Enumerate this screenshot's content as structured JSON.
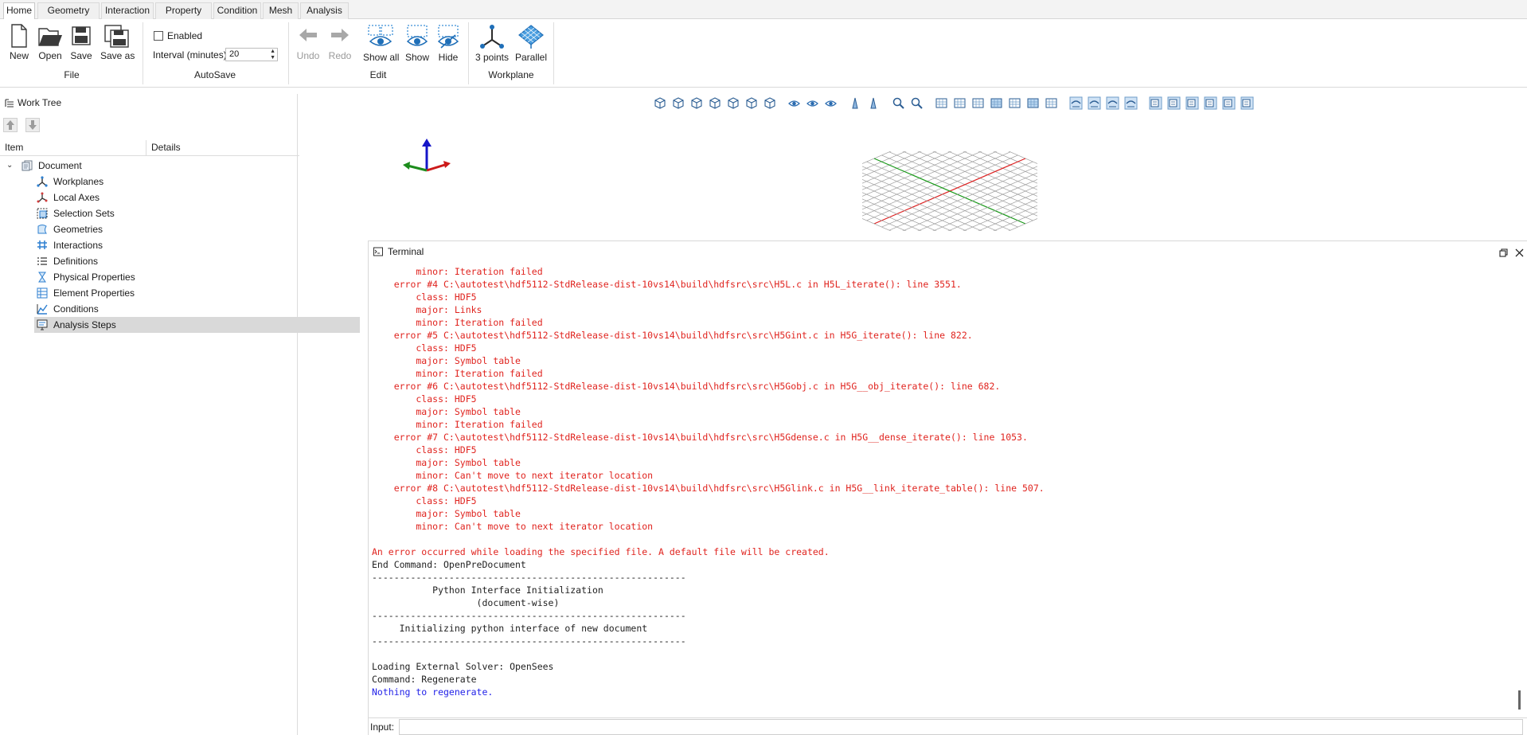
{
  "ribbon": {
    "tabs": [
      "Home",
      "Geometry",
      "Interaction",
      "Property",
      "Condition",
      "Mesh",
      "Analysis"
    ],
    "active_tab": "Home",
    "file_group": {
      "label": "File",
      "new": "New",
      "open": "Open",
      "save": "Save",
      "save_as": "Save as"
    },
    "autosave_group": {
      "label": "AutoSave",
      "enabled_label": "Enabled",
      "enabled": false,
      "interval_label": "Interval (minutes)",
      "interval_value": "20"
    },
    "edit_group": {
      "label": "Edit",
      "undo": "Undo",
      "redo": "Redo",
      "show_all": "Show all",
      "show": "Show",
      "hide": "Hide"
    },
    "workplane_group": {
      "label": "Workplane",
      "three_points": "3 points",
      "parallel": "Parallel"
    }
  },
  "worktree": {
    "title": "Work Tree",
    "columns": [
      "Item",
      "Details"
    ],
    "root": "Document",
    "items": [
      {
        "label": "Workplanes",
        "icon": "workplane-icon"
      },
      {
        "label": "Local Axes",
        "icon": "axes-icon"
      },
      {
        "label": "Selection Sets",
        "icon": "selection-set-icon"
      },
      {
        "label": "Geometries",
        "icon": "geometry-icon"
      },
      {
        "label": "Interactions",
        "icon": "interaction-icon"
      },
      {
        "label": "Definitions",
        "icon": "definition-list-icon"
      },
      {
        "label": "Physical Properties",
        "icon": "physical-property-icon"
      },
      {
        "label": "Element Properties",
        "icon": "element-property-icon"
      },
      {
        "label": "Conditions",
        "icon": "condition-icon"
      },
      {
        "label": "Analysis Steps",
        "icon": "analysis-step-icon"
      }
    ],
    "selected_item": "Analysis Steps"
  },
  "terminal": {
    "title": "Terminal",
    "input_label": "Input:",
    "input_value": "",
    "colors": {
      "error": "#e0241f",
      "normal": "#222222",
      "info": "#1f1fe8"
    },
    "lines": [
      {
        "text": "        minor: Iteration failed",
        "kind": "error"
      },
      {
        "text": "    error #4 C:\\autotest\\hdf5112-StdRelease-dist-10vs14\\build\\hdfsrc\\src\\H5L.c in H5L_iterate(): line 3551.",
        "kind": "error"
      },
      {
        "text": "        class: HDF5",
        "kind": "error"
      },
      {
        "text": "        major: Links",
        "kind": "error"
      },
      {
        "text": "        minor: Iteration failed",
        "kind": "error"
      },
      {
        "text": "    error #5 C:\\autotest\\hdf5112-StdRelease-dist-10vs14\\build\\hdfsrc\\src\\H5Gint.c in H5G_iterate(): line 822.",
        "kind": "error"
      },
      {
        "text": "        class: HDF5",
        "kind": "error"
      },
      {
        "text": "        major: Symbol table",
        "kind": "error"
      },
      {
        "text": "        minor: Iteration failed",
        "kind": "error"
      },
      {
        "text": "    error #6 C:\\autotest\\hdf5112-StdRelease-dist-10vs14\\build\\hdfsrc\\src\\H5Gobj.c in H5G__obj_iterate(): line 682.",
        "kind": "error"
      },
      {
        "text": "        class: HDF5",
        "kind": "error"
      },
      {
        "text": "        major: Symbol table",
        "kind": "error"
      },
      {
        "text": "        minor: Iteration failed",
        "kind": "error"
      },
      {
        "text": "    error #7 C:\\autotest\\hdf5112-StdRelease-dist-10vs14\\build\\hdfsrc\\src\\H5Gdense.c in H5G__dense_iterate(): line 1053.",
        "kind": "error"
      },
      {
        "text": "        class: HDF5",
        "kind": "error"
      },
      {
        "text": "        major: Symbol table",
        "kind": "error"
      },
      {
        "text": "        minor: Can't move to next iterator location",
        "kind": "error"
      },
      {
        "text": "    error #8 C:\\autotest\\hdf5112-StdRelease-dist-10vs14\\build\\hdfsrc\\src\\H5Glink.c in H5G__link_iterate_table(): line 507.",
        "kind": "error"
      },
      {
        "text": "        class: HDF5",
        "kind": "error"
      },
      {
        "text": "        major: Symbol table",
        "kind": "error"
      },
      {
        "text": "        minor: Can't move to next iterator location",
        "kind": "error"
      },
      {
        "text": "",
        "kind": "normal"
      },
      {
        "text": "An error occurred while loading the specified file. A default file will be created.",
        "kind": "error"
      },
      {
        "text": "End Command: OpenPreDocument",
        "kind": "normal"
      },
      {
        "text": "---------------------------------------------------------",
        "kind": "normal"
      },
      {
        "text": "           Python Interface Initialization",
        "kind": "normal"
      },
      {
        "text": "                   (document-wise)",
        "kind": "normal"
      },
      {
        "text": "---------------------------------------------------------",
        "kind": "normal"
      },
      {
        "text": "     Initializing python interface of new document",
        "kind": "normal"
      },
      {
        "text": "---------------------------------------------------------",
        "kind": "normal"
      },
      {
        "text": "",
        "kind": "normal"
      },
      {
        "text": "Loading External Solver: OpenSees",
        "kind": "normal"
      },
      {
        "text": "Command: Regenerate",
        "kind": "normal"
      },
      {
        "text": "Nothing to regenerate.",
        "kind": "info"
      }
    ]
  },
  "viewport": {
    "toolbar_icons": [
      "iso-view-icon",
      "front-view-icon",
      "back-view-icon",
      "left-view-icon",
      "right-view-icon",
      "top-view-icon",
      "bottom-view-icon",
      "eye-icon",
      "eye-show-icon",
      "eye-hide-icon",
      "mirror-icon",
      "section-plane-icon",
      "zoom-fit-icon",
      "zoom-icon",
      "screenshot-icon",
      "pen-icon",
      "grid-icon",
      "grid-active-icon",
      "axes-toggle-icon",
      "select-box-icon",
      "select-add-icon",
      "view-mode-1-icon",
      "view-mode-2-icon",
      "view-mode-3-icon",
      "view-mode-4-icon",
      "render-mode-1-icon",
      "render-mode-2-icon",
      "render-mode-3-icon",
      "render-mode-4-icon",
      "render-mode-5-icon",
      "render-mode-6-icon"
    ]
  }
}
